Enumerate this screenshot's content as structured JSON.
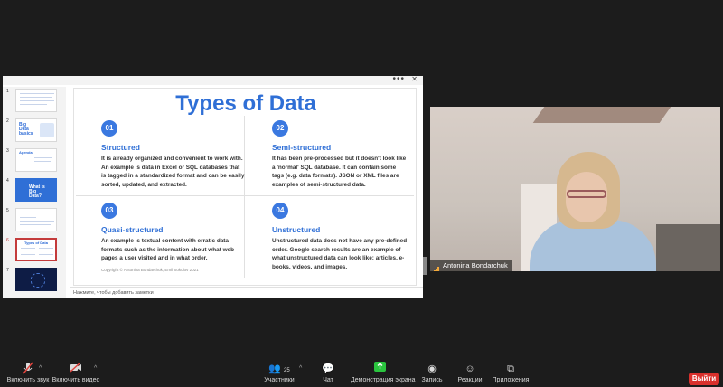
{
  "slide": {
    "title": "Types of Data",
    "quadrants": [
      {
        "num": "01",
        "heading": "Structured",
        "text": "It is already organized and convenient to work with. An example is data in Excel or SQL databases that is tagged in a standardized format and can be easily sorted, updated, and extracted."
      },
      {
        "num": "02",
        "heading": "Semi-structured",
        "text": "It has been pre-processed but it doesn't look like a 'normal' SQL database. It can contain some tags (e.g. data formats). JSON or XML files are examples of semi-structured data."
      },
      {
        "num": "03",
        "heading": "Quasi-structured",
        "text": "An example is textual content with erratic data formats such as the information about what web pages a user visited and in what order."
      },
      {
        "num": "04",
        "heading": "Unstructured",
        "text": "Unstructured data does not have any pre-defined order. Google search results are an example of what unstructured data can look like: articles, e-books, videos, and images."
      }
    ],
    "copyright": "Copyright © Antonina Bondarchuk, Emil Sokolov 2021"
  },
  "notes_placeholder": "Нажмите, чтобы добавить заметки",
  "thumbnails": [
    {
      "num": "1",
      "style": "light"
    },
    {
      "num": "2",
      "style": "light",
      "label": "Big Data basics"
    },
    {
      "num": "3",
      "style": "light",
      "label": "Agenda"
    },
    {
      "num": "4",
      "style": "blue",
      "label": "What is Big Data?"
    },
    {
      "num": "5",
      "style": "light"
    },
    {
      "num": "6",
      "style": "light",
      "selected": true,
      "label": "Types of Data"
    },
    {
      "num": "7",
      "style": "dark"
    }
  ],
  "participant_name": "Antonina Bondarchuk",
  "toolbar": {
    "mute": "Включить звук",
    "video": "Включить видео",
    "participants": "Участники",
    "participants_count": "25",
    "chat": "Чат",
    "share": "Демонстрация экрана",
    "record": "Запись",
    "reactions": "Реакции",
    "apps": "Приложения",
    "leave": "Выйти"
  },
  "colors": {
    "accent": "#2f6fd6",
    "leave": "#d9302c",
    "share": "#2ac43e"
  }
}
